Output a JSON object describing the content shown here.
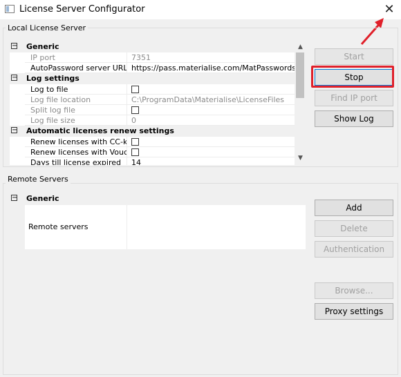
{
  "window": {
    "title": "License Server Configurator",
    "close_glyph": "✕",
    "icon": "app-window-icon"
  },
  "local": {
    "group_label": "Local License Server",
    "categories": {
      "generic": "Generic",
      "log": "Log settings",
      "auto": "Automatic licenses renew settings"
    },
    "expander_glyph": "−",
    "rows": {
      "ip_port": {
        "name": "IP port",
        "value": "7351"
      },
      "autopassword": {
        "name": "AutoPassword server URL",
        "value": "https://pass.materialise.com/MatPasswordsWS/M"
      },
      "log_to_file": {
        "name": "Log to file"
      },
      "log_file_location": {
        "name": "Log file location",
        "value": "C:\\ProgramData\\Materialise\\LicenseFiles"
      },
      "split_log_file": {
        "name": "Split log file"
      },
      "log_file_size": {
        "name": "Log file size",
        "value": "0"
      },
      "renew_cc": {
        "name": "Renew licenses with CC-key"
      },
      "renew_voucher": {
        "name": "Renew licenses with Vouch..."
      },
      "days_till": {
        "name": "Days till license expired",
        "value": "14"
      }
    },
    "buttons": {
      "start": "Start",
      "stop": "Stop",
      "find_ip": "Find IP port",
      "show_log": "Show Log"
    }
  },
  "remote": {
    "group_label": "Remote Servers",
    "category": "Generic",
    "row_name": "Remote servers",
    "buttons": {
      "add": "Add",
      "delete": "Delete",
      "authentication": "Authentication",
      "browse": "Browse...",
      "proxy": "Proxy settings"
    }
  },
  "colors": {
    "highlight": "#e0202a",
    "accent_border": "#0078d7"
  }
}
